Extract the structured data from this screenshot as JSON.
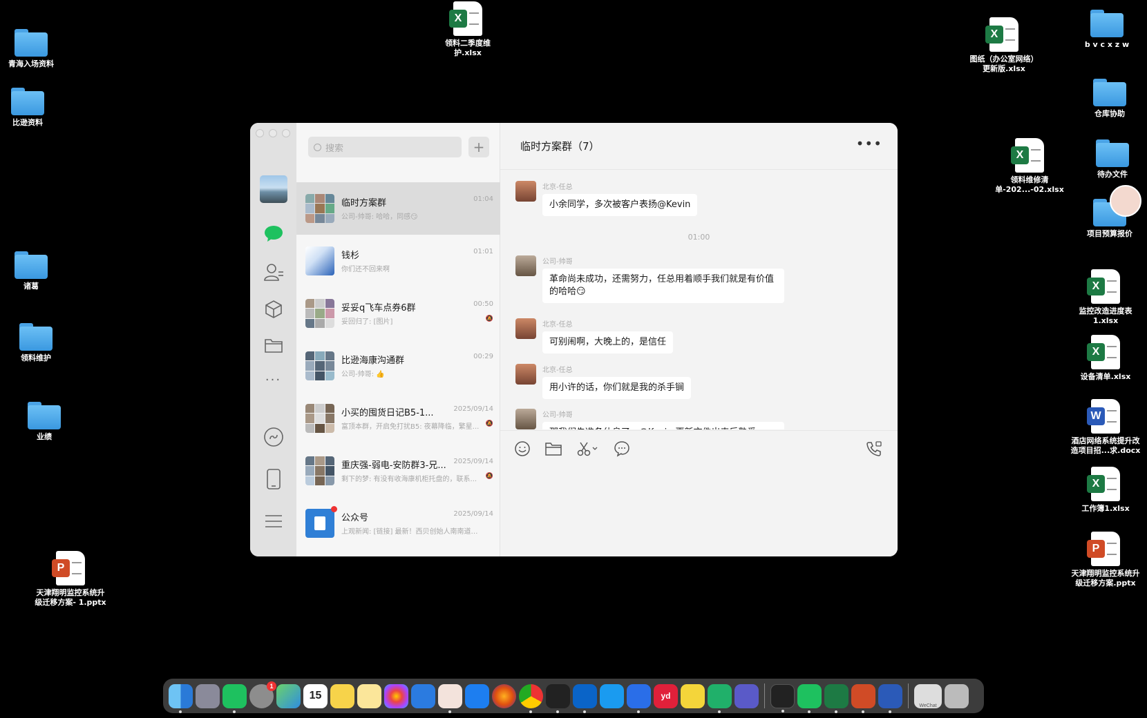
{
  "desktop": {
    "icons": [
      {
        "label": "青海入场资料",
        "kind": "folder"
      },
      {
        "label": "比逊资料",
        "kind": "folder"
      },
      {
        "label": "诸葛",
        "kind": "folder"
      },
      {
        "label": "领料维护",
        "kind": "folder"
      },
      {
        "label": "业绩",
        "kind": "folder"
      },
      {
        "label": "天津翔明监控系统升\n级迁移方案- 1.pptx",
        "kind": "pptx"
      },
      {
        "label": "领料二季度维\n护.xlsx",
        "kind": "xlsx"
      },
      {
        "label": "图纸（办公室网络）\n更新版.xlsx",
        "kind": "xlsx"
      },
      {
        "label": "b v c x z w",
        "kind": "folder"
      },
      {
        "label": "仓库协助",
        "kind": "folder"
      },
      {
        "label": "领料维修清\n单-202...-02.xlsx",
        "kind": "xlsx"
      },
      {
        "label": "待办文件",
        "kind": "folder"
      },
      {
        "label": "项目预算报价",
        "kind": "folder"
      },
      {
        "label": "监控改造进度表\n1.xlsx",
        "kind": "xlsx"
      },
      {
        "label": "设备清单.xlsx",
        "kind": "xlsx"
      },
      {
        "label": "酒店网络系统提升改\n造项目招...求.docx",
        "kind": "docx"
      },
      {
        "label": "工作簿1.xlsx",
        "kind": "xlsx"
      },
      {
        "label": "天津翔明监控系统升\n级迁移方案.pptx",
        "kind": "pptx"
      }
    ]
  },
  "wechat": {
    "search_placeholder": "搜索",
    "add_label": "+",
    "conversations": [
      {
        "name": "临时方案群",
        "time": "01:04",
        "preview": "公司-帅哥: 哈哈，同感😏",
        "active": true
      },
      {
        "name": "钱杉",
        "time": "01:01",
        "preview": "你们还不回来啊"
      },
      {
        "name": "妥妥q飞车点券6群",
        "time": "00:50",
        "preview": "妥回归了: [图片]",
        "muted": true
      },
      {
        "name": "比逊海康沟通群",
        "time": "00:29",
        "preview": "公司-帅哥: 👍"
      },
      {
        "name": "小买的囤货日记B5-1...",
        "time": "2025/09/14",
        "preview": "富顶本群，开启免打扰B5: 夜幕降临，繁星...",
        "muted": true
      },
      {
        "name": "重庆强-弱电-安防群3-兄...",
        "time": "2025/09/14",
        "preview": "剩下的梦: 有没有收海康机柜托盘的，联系...",
        "muted": true
      },
      {
        "name": "公众号",
        "time": "2025/09/14",
        "preview": "上观新闻: [链接] 最新！西贝创始人南南道歉..."
      }
    ],
    "chat": {
      "title": "临时方案群（7）",
      "more": "•••",
      "messages": [
        {
          "sender": "北京-任总",
          "text": "小余同学，多次被客户表扬@Kevin"
        },
        {
          "timestamp": "01:00"
        },
        {
          "sender": "公司-帅哥",
          "text": "革命尚未成功，还需努力，任总用着顺手我们就是有价值的哈哈😏"
        },
        {
          "sender": "北京-任总",
          "text": "可别闹啊，大晚上的，是信任"
        },
        {
          "sender": "北京-任总",
          "text": "用小许的话，你们就是我的杀手锏"
        },
        {
          "sender": "公司-帅哥",
          "text": "那我们先准备休息了，@Kevin 更新文件出来后熟悉一下，明天配合好会议记录，技术问题尽量还是 @海康-张"
        }
      ]
    }
  },
  "dock": {
    "calendar_day": "15",
    "settings_badge": "1",
    "wechat_thumb_label": "WeChat"
  }
}
